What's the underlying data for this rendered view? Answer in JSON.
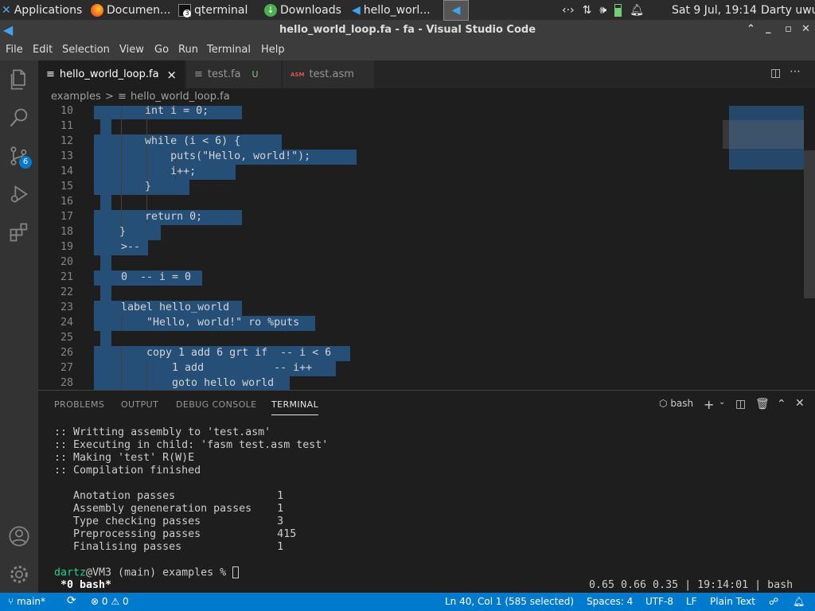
{
  "taskbar": {
    "items": [
      {
        "label": "Applications"
      },
      {
        "label": "Documen..."
      },
      {
        "label": "qterminal",
        "badge": "3"
      },
      {
        "label": "Downloads"
      },
      {
        "label": "hello_worl..."
      }
    ],
    "clock": "Sat  9 Jul, 19:14",
    "user": "Darty uwu"
  },
  "window": {
    "title": "hello_world_loop.fa - fa - Visual Studio Code"
  },
  "menu": [
    "File",
    "Edit",
    "Selection",
    "View",
    "Go",
    "Run",
    "Terminal",
    "Help"
  ],
  "activity": {
    "scm_badge": "6"
  },
  "tabs": [
    {
      "label": "hello_world_loop.fa",
      "icon": "≡",
      "close": "×"
    },
    {
      "label": "test.fa",
      "icon": "≡",
      "status": "U"
    },
    {
      "label": "test.asm",
      "icon": "ASM"
    }
  ],
  "breadcrumb": {
    "folder": "examples",
    "sep": ">",
    "file": "hello_world_loop.fa"
  },
  "editor": {
    "lines": [
      {
        "n": "10",
        "code": "        int i = 0;"
      },
      {
        "n": "11",
        "code": ""
      },
      {
        "n": "12",
        "code": "        while (i < 6) {"
      },
      {
        "n": "13",
        "code": "            puts(\"Hello, world!\");"
      },
      {
        "n": "14",
        "code": "            i++;"
      },
      {
        "n": "15",
        "code": "        }"
      },
      {
        "n": "16",
        "code": ""
      },
      {
        "n": "17",
        "code": "        return 0;"
      },
      {
        "n": "18",
        "code": "    }"
      },
      {
        "n": "19",
        "code": ">--"
      },
      {
        "n": "20",
        "code": ""
      },
      {
        "n": "21",
        "code": "0  -- i = 0"
      },
      {
        "n": "22",
        "code": ""
      },
      {
        "n": "23",
        "code": "label hello_world"
      },
      {
        "n": "24",
        "code": "    \"Hello, world!\" ro %puts"
      },
      {
        "n": "25",
        "code": ""
      },
      {
        "n": "26",
        "code": "    copy 1 add 6 grt if  -- i < 6"
      },
      {
        "n": "27",
        "code": "        1 add           -- i++"
      },
      {
        "n": "28",
        "code": "        goto hello world"
      }
    ]
  },
  "panel": {
    "tabs": [
      "PROBLEMS",
      "OUTPUT",
      "DEBUG CONSOLE",
      "TERMINAL"
    ],
    "shell": "bash",
    "terminal_lines": [
      ":: Writting assembly to 'test.asm'",
      ":: Executing in child: 'fasm test.asm test'",
      ":: Making 'test' R(W)E",
      ":: Compilation finished",
      "",
      "  Anotation passes                1",
      "  Assembly geneneration passes    1",
      "  Type checking passes            3",
      "  Preprocessing passes            415",
      "  Finalising passes               1",
      ""
    ],
    "prompt_user": "dartz",
    "prompt_rest": "@VM3 (main) examples % ",
    "tmux_window": " *0 bash*",
    "tmux_status": "0.65 0.66 0.35 | 19:14:01 | bash"
  },
  "status": {
    "branch": "main*",
    "errors": "0",
    "warnings": "0",
    "cursor": "Ln 40, Col 1 (585 selected)",
    "spaces": "Spaces: 4",
    "encoding": "UTF-8",
    "eol": "LF",
    "language": "Plain Text"
  },
  "colors": {
    "accent": "#007acc",
    "selection": "#264f78"
  }
}
